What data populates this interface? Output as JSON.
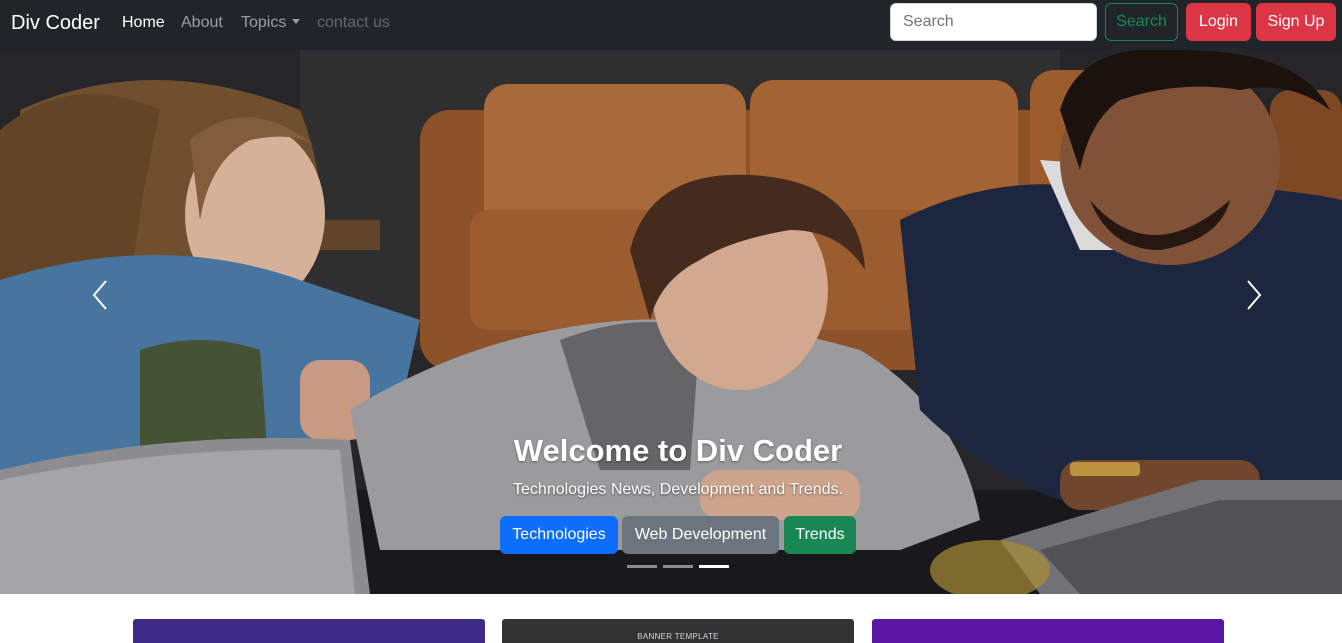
{
  "navbar": {
    "brand": "Div Coder",
    "links": [
      {
        "label": "Home"
      },
      {
        "label": "About"
      },
      {
        "label": "Topics"
      },
      {
        "label": "contact us"
      }
    ],
    "search": {
      "placeholder": "Search",
      "button_label": "Search"
    },
    "login_label": "Login",
    "signup_label": "Sign Up"
  },
  "carousel": {
    "title": "Welcome to Div Coder",
    "subtitle": "Technologies News, Development and Trends.",
    "buttons": [
      {
        "label": "Technologies",
        "color": "#0d6efd"
      },
      {
        "label": "Web Development",
        "color": "#6c757d"
      },
      {
        "label": "Trends",
        "color": "#198754"
      }
    ],
    "slide_count": 3,
    "active_slide": 3
  },
  "cards": [
    {
      "banner_text": ""
    },
    {
      "banner_text": "BANNER TEMPLATE"
    },
    {
      "banner_text": ""
    }
  ],
  "colors": {
    "navbar_bg": "#212529",
    "danger": "#dc3545",
    "success": "#198754",
    "primary": "#0d6efd",
    "secondary": "#6c757d"
  }
}
